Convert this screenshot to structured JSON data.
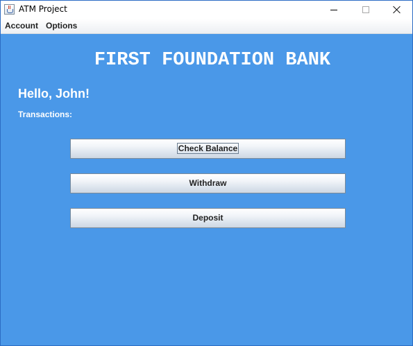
{
  "window": {
    "title": "ATM Project",
    "icon": "java-cup-icon"
  },
  "menubar": {
    "items": [
      {
        "label": "Account"
      },
      {
        "label": "Options"
      }
    ]
  },
  "main": {
    "bank_name": "FIRST FOUNDATION BANK",
    "greeting": "Hello, John!",
    "transactions_label": "Transactions:",
    "buttons": [
      {
        "label": "Check Balance",
        "focused": true
      },
      {
        "label": "Withdraw",
        "focused": false
      },
      {
        "label": "Deposit",
        "focused": false
      }
    ]
  },
  "colors": {
    "background": "#4a98e8",
    "text_on_background": "#ffffff"
  }
}
